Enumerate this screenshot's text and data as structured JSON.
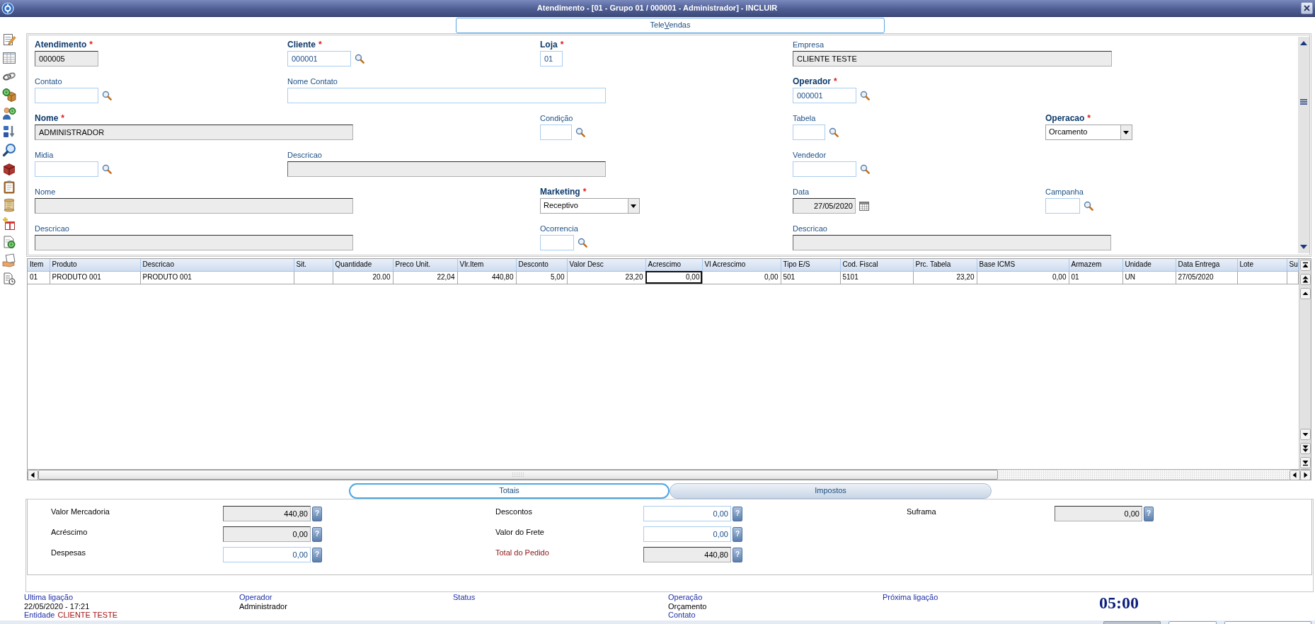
{
  "window": {
    "title": "Atendimento - [01 - Grupo 01 / 000001 - Administrador] - INCLUIR"
  },
  "top_tabs": [
    {
      "label": "Tele",
      "mnemonic": "V",
      "label_rest": "endas",
      "selected": true
    }
  ],
  "form": {
    "fields": [
      {
        "label": "Atendimento",
        "required": true,
        "marker": "*",
        "kind": "text",
        "readonly": true,
        "value": "000005"
      },
      {
        "label": "Cliente",
        "required": true,
        "marker": "*",
        "kind": "lookup",
        "readonly": false,
        "value": "000001"
      },
      {
        "label": "Loja",
        "required": true,
        "marker": "*",
        "kind": "text",
        "readonly": false,
        "value": "01"
      },
      {
        "label": "Empresa",
        "required": false,
        "kind": "text",
        "readonly": true,
        "value": "CLIENTE TESTE"
      },
      {
        "label": "Contato",
        "required": false,
        "kind": "lookup",
        "readonly": false
      },
      {
        "label": "Nome Contato",
        "required": false,
        "kind": "text",
        "readonly": false
      },
      {
        "label": "Operador",
        "required": true,
        "marker": "*",
        "kind": "lookup",
        "readonly": false,
        "value": "000001"
      },
      {
        "label": "Nome",
        "required": true,
        "marker": "*",
        "kind": "text",
        "readonly": true,
        "value": "ADMINISTRADOR"
      },
      {
        "label": "Condição",
        "required": false,
        "kind": "lookup",
        "readonly": false
      },
      {
        "label": "Tabela",
        "required": false,
        "kind": "lookup",
        "readonly": false
      },
      {
        "label": "Operacao",
        "required": true,
        "marker": "*",
        "kind": "select",
        "readonly": false,
        "value": "Orcamento"
      },
      {
        "label": "Midia",
        "required": false,
        "kind": "lookup",
        "readonly": false
      },
      {
        "label": "Descricao",
        "required": false,
        "kind": "text",
        "readonly": true
      },
      {
        "label": "Vendedor",
        "required": false,
        "kind": "lookup",
        "readonly": false
      },
      {
        "label": "Nome",
        "required": false,
        "kind": "text",
        "readonly": true
      },
      {
        "label": "Marketing",
        "required": true,
        "marker": "*",
        "kind": "select",
        "readonly": false,
        "value": "Receptivo"
      },
      {
        "label": "Data",
        "required": false,
        "kind": "date",
        "readonly": true,
        "value": "27/05/2020"
      },
      {
        "label": "Campanha",
        "required": false,
        "kind": "lookup",
        "readonly": false
      },
      {
        "label": "Descricao",
        "required": false,
        "kind": "text",
        "readonly": true
      },
      {
        "label": "Ocorrencia",
        "required": false,
        "kind": "lookup",
        "readonly": false
      },
      {
        "label": "Descricao",
        "required": false,
        "kind": "text",
        "readonly": true
      }
    ]
  },
  "grid": {
    "columns": [
      {
        "label": "Item",
        "kind": "text"
      },
      {
        "label": "Produto",
        "kind": "text"
      },
      {
        "label": "Descricao",
        "kind": "text"
      },
      {
        "label": "Sit.",
        "kind": "text"
      },
      {
        "label": "Quantidade",
        "kind": "number"
      },
      {
        "label": "Preco Unit.",
        "kind": "number"
      },
      {
        "label": "Vlr.Item",
        "kind": "number"
      },
      {
        "label": "Desconto",
        "kind": "number"
      },
      {
        "label": "Valor Desc",
        "kind": "number"
      },
      {
        "label": "Acrescimo",
        "kind": "number"
      },
      {
        "label": "Vl Acrescimo",
        "kind": "number"
      },
      {
        "label": "Tipo E/S",
        "kind": "text"
      },
      {
        "label": "Cod. Fiscal",
        "kind": "text"
      },
      {
        "label": "Prc. Tabela",
        "kind": "number"
      },
      {
        "label": "Base ICMS",
        "kind": "number"
      },
      {
        "label": "Armazem",
        "kind": "text"
      },
      {
        "label": "Unidade",
        "kind": "text"
      },
      {
        "label": "Data Entrega",
        "kind": "text"
      },
      {
        "label": "Lote",
        "kind": "text"
      },
      {
        "label": "Su",
        "kind": "text"
      }
    ],
    "rows": [
      {
        "cells": [
          {
            "text": "01",
            "focused": false
          },
          {
            "text": "PRODUTO 001",
            "focused": false
          },
          {
            "text": "PRODUTO 001",
            "focused": false
          },
          {
            "focused": false
          },
          {
            "text": "20.00",
            "focused": false
          },
          {
            "text": "22,04",
            "focused": false
          },
          {
            "text": "440,80",
            "focused": false
          },
          {
            "text": "5,00",
            "focused": false
          },
          {
            "text": "23,20",
            "focused": false
          },
          {
            "text": "0,00",
            "focused": true
          },
          {
            "text": "0,00",
            "focused": false
          },
          {
            "text": "501",
            "focused": false
          },
          {
            "text": "5101",
            "focused": false
          },
          {
            "text": "23,20",
            "focused": false
          },
          {
            "text": "0,00",
            "focused": false
          },
          {
            "text": "01",
            "focused": false
          },
          {
            "text": "UN",
            "focused": false
          },
          {
            "text": "27/05/2020",
            "focused": false
          },
          {
            "focused": false
          },
          {
            "focused": false
          }
        ]
      }
    ]
  },
  "bottom_tabs": [
    {
      "label": "Totais",
      "selected": true
    },
    {
      "label": "Impostos",
      "selected": false
    }
  ],
  "totals": {
    "rows": [
      [
        {
          "label": "Valor Mercadoria",
          "value": "440,80",
          "readonly": true,
          "highlighted": false,
          "help": "?"
        },
        {
          "label": "Descontos",
          "value": "0,00",
          "readonly": false,
          "highlighted": false,
          "help": "?"
        },
        {
          "label": "Suframa",
          "value": "0,00",
          "readonly": true,
          "highlighted": false,
          "help": "?"
        }
      ],
      [
        {
          "label": "Acréscimo",
          "value": "0,00",
          "readonly": true,
          "highlighted": false,
          "help": "?"
        },
        {
          "label": "Valor do Frete",
          "value": "0,00",
          "readonly": false,
          "highlighted": false,
          "help": "?"
        }
      ],
      [
        {
          "label": "Despesas",
          "value": "0,00",
          "readonly": false,
          "highlighted": false,
          "help": "?"
        },
        {
          "label": "Total do Pedido",
          "value": "440,80",
          "readonly": true,
          "highlighted": true,
          "help": "?"
        }
      ]
    ]
  },
  "status_bar": {
    "fields": [
      {
        "label": "Ultima ligação",
        "value": "22/05/2020 - 17:21",
        "sub_label": "Entidade",
        "sub_value": "CLIENTE TESTE"
      },
      {
        "label": "Operador",
        "value": "Administrador"
      },
      {
        "label": "Status"
      },
      {
        "label": "Operação",
        "value": "Orçamento",
        "sub_label": "Contato"
      },
      {
        "label": "Próxima ligação"
      }
    ],
    "timer": "05:00"
  }
}
